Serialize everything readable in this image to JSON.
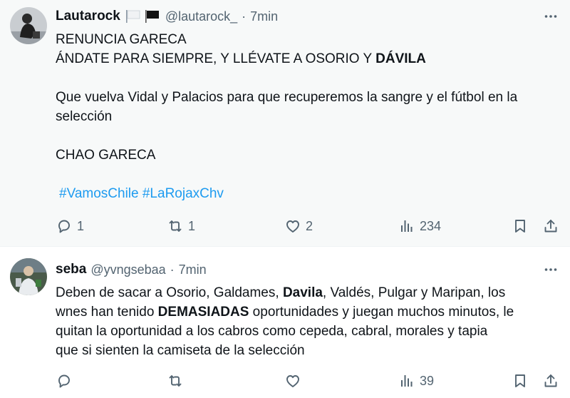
{
  "tweets": [
    {
      "display_name": "Lautarock",
      "handle": "@lautarock_",
      "separator": "·",
      "time": "7min",
      "lines": [
        "RENUNCIA GARECA",
        "ÁNDATE PARA SIEMPRE, Y LLÉVATE A OSORIO Y ",
        "DÁVILA",
        "Que vuelva Vidal y Palacios para que recuperemos la sangre y el fútbol en la",
        "selección",
        "CHAO GARECA",
        "#VamosChile #LaRojaxChv"
      ],
      "replies": "1",
      "retweets": "1",
      "likes": "2",
      "views": "234"
    },
    {
      "display_name": "seba",
      "handle": "@yvngsebaa",
      "separator": "·",
      "time": "7min",
      "l1_a": "Deben de sacar a Osorio, Galdames, ",
      "l1_b": "Davila",
      "l1_c": ", Valdés, Pulgar y Maripan, los",
      "l2_a": "wnes han tenido ",
      "l2_b": "DEMASIADAS",
      "l2_c": " oportunidades y juegan muchos minutos, le",
      "l3": "quitan la oportunidad a los cabros como cepeda, cabral, morales y tapia",
      "l4": "que si sienten la camiseta de la selección",
      "views": "39"
    }
  ],
  "colors": {
    "text": "#0f1419",
    "secondary": "#536471",
    "hashtag": "#1d9bf0",
    "tweet1_bg": "#f7f9f9"
  },
  "icons": [
    "more-icon",
    "reply-icon",
    "retweet-icon",
    "like-icon",
    "views-icon",
    "bookmark-icon",
    "share-icon",
    "white-flag-icon",
    "black-flag-icon"
  ]
}
